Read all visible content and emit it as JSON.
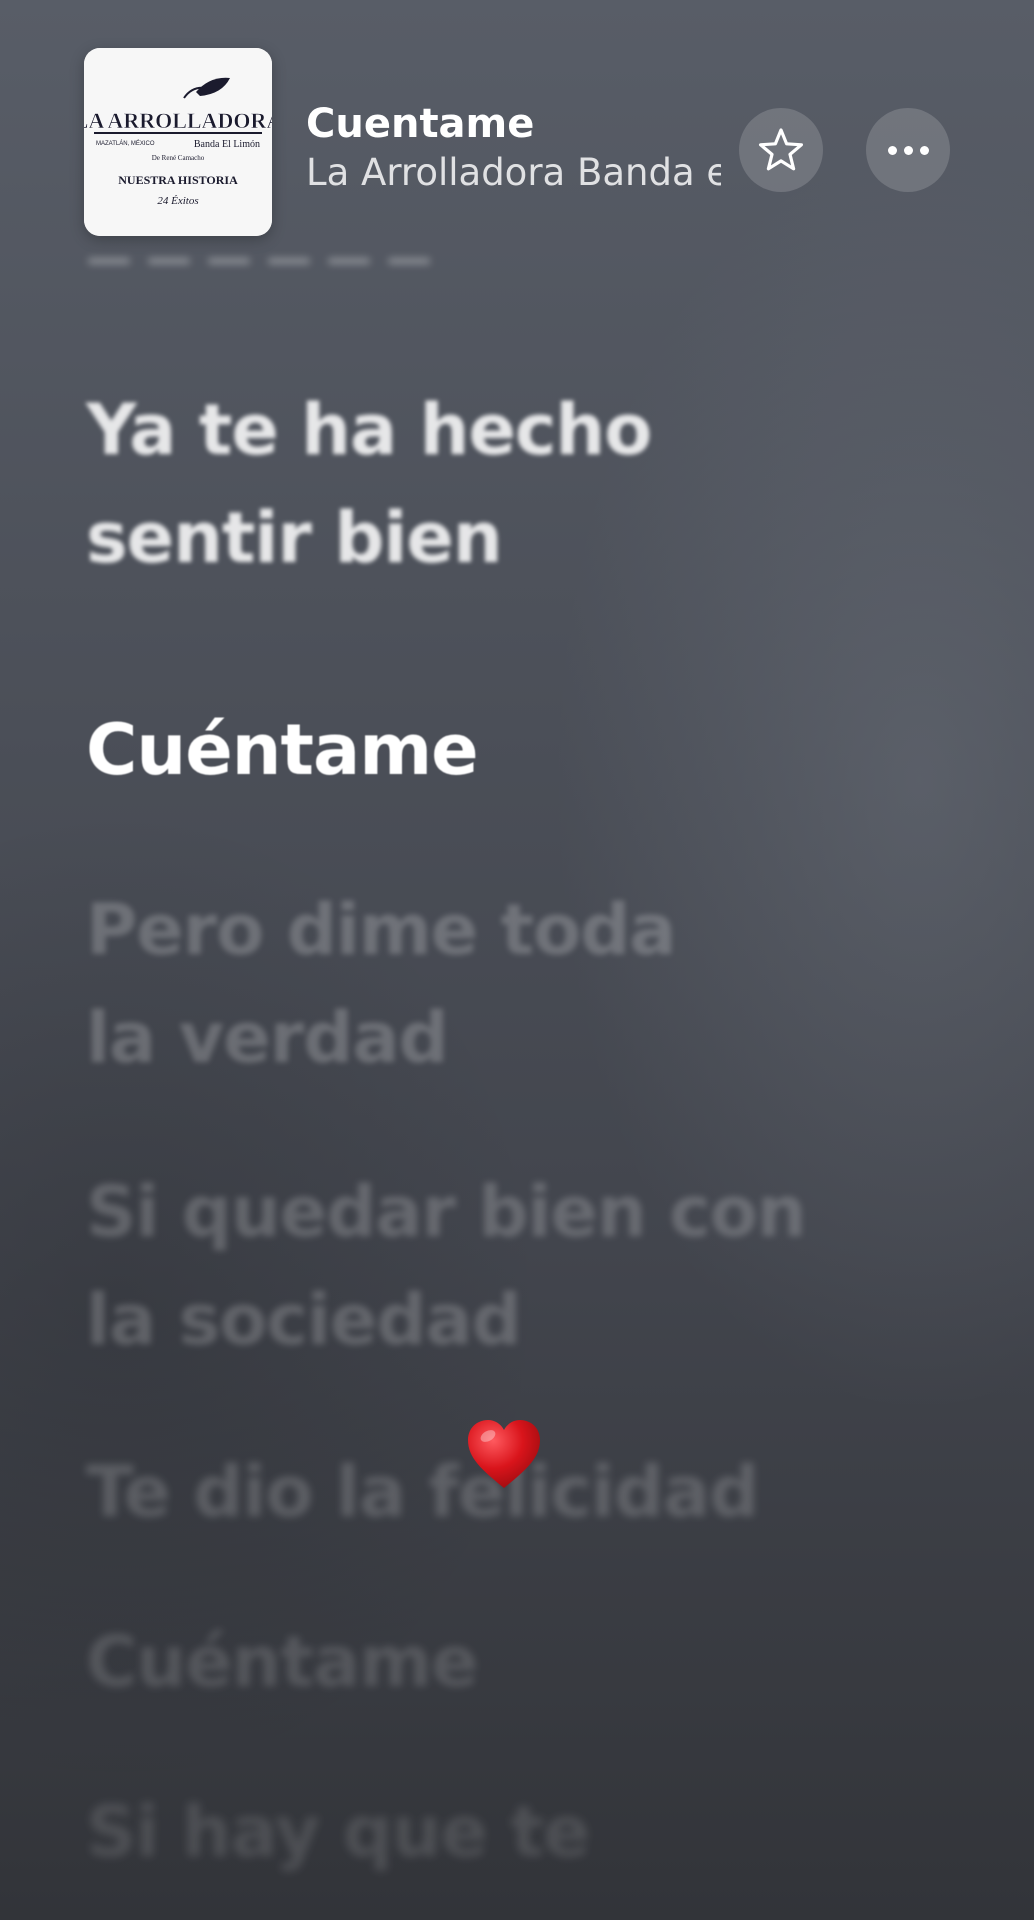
{
  "track": {
    "title": "Cuentame",
    "artist": "La Arrolladora Banda el Limón",
    "artwork": {
      "name": "LA ARROLLADORA",
      "subtitle_left": "MAZATLÁN, MÉXICO",
      "subtitle_right": "Banda El Limón",
      "tagline": "De René Camacho",
      "album": "NUESTRA HISTORIA",
      "extra": "24 Éxitos"
    }
  },
  "buttons": {
    "favorite_icon": "star-icon",
    "more_icon": "ellipsis-icon"
  },
  "lyrics": {
    "previous_faded": "— — — — — —",
    "previous": [
      "Ya te ha hecho",
      "sentir bien"
    ],
    "current": "Cuéntame",
    "upcoming": [
      [
        "Pero dime toda",
        "la verdad"
      ],
      [
        "Si quedar bien con",
        "la sociedad"
      ],
      [
        "Te dio la felicidad"
      ],
      [
        "Cuéntame"
      ],
      [
        "Si hay que te"
      ]
    ]
  },
  "reaction": {
    "icon": "heart-icon",
    "color": "#d9141b"
  }
}
